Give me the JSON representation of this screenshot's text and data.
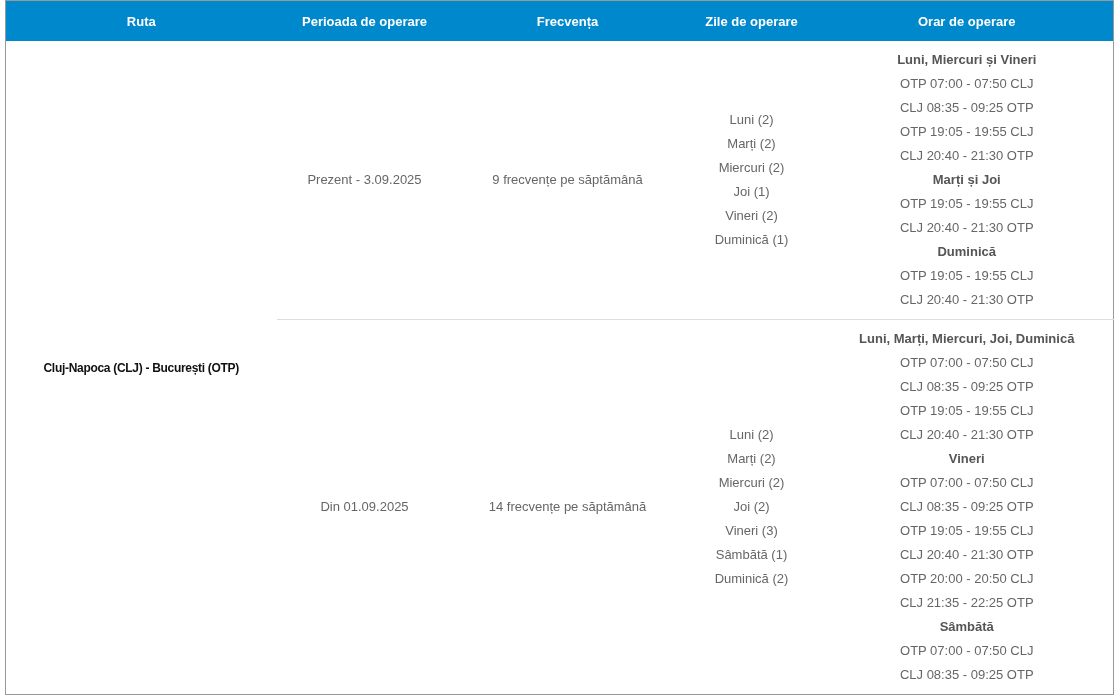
{
  "table": {
    "columns": [
      "Ruta",
      "Perioada de operare",
      "Frecvența",
      "Zile de operare",
      "Orar de operare"
    ],
    "route": "Cluj-Napoca (CLJ) - București (OTP)",
    "rows": [
      {
        "period": "Prezent - 3.09.2025",
        "frequency": "9 frecvențe pe săptămână",
        "days": [
          "Luni (2)",
          "Marți (2)",
          "Miercuri (2)",
          "Joi (1)",
          "Vineri (2)",
          "Duminică (1)"
        ],
        "schedule": [
          {
            "kind": "heading",
            "text": "Luni, Miercuri și Vineri"
          },
          {
            "kind": "time",
            "text": "OTP 07:00 - 07:50 CLJ"
          },
          {
            "kind": "time",
            "text": "CLJ 08:35 - 09:25 OTP"
          },
          {
            "kind": "time",
            "text": "OTP 19:05 - 19:55 CLJ"
          },
          {
            "kind": "time",
            "text": "CLJ 20:40 - 21:30 OTP"
          },
          {
            "kind": "heading",
            "text": "Marți și Joi"
          },
          {
            "kind": "time",
            "text": "OTP 19:05 - 19:55 CLJ"
          },
          {
            "kind": "time",
            "text": "CLJ 20:40 - 21:30 OTP"
          },
          {
            "kind": "heading",
            "text": "Duminică"
          },
          {
            "kind": "time",
            "text": "OTP 19:05 - 19:55 CLJ"
          },
          {
            "kind": "time",
            "text": "CLJ 20:40 - 21:30 OTP"
          }
        ]
      },
      {
        "period": "Din 01.09.2025",
        "frequency": "14 frecvențe pe săptămână",
        "days": [
          "Luni (2)",
          "Marți (2)",
          "Miercuri (2)",
          "Joi (2)",
          "Vineri (3)",
          "Sâmbătă (1)",
          "Duminică (2)"
        ],
        "schedule": [
          {
            "kind": "heading",
            "text": "Luni, Marți, Miercuri, Joi, Duminică"
          },
          {
            "kind": "time",
            "text": "OTP 07:00 - 07:50 CLJ"
          },
          {
            "kind": "time",
            "text": "CLJ 08:35 - 09:25 OTP"
          },
          {
            "kind": "time",
            "text": "OTP 19:05 - 19:55 CLJ"
          },
          {
            "kind": "time",
            "text": "CLJ 20:40 - 21:30 OTP"
          },
          {
            "kind": "heading",
            "text": "Vineri"
          },
          {
            "kind": "time",
            "text": "OTP 07:00 - 07:50 CLJ"
          },
          {
            "kind": "time",
            "text": "CLJ 08:35 - 09:25 OTP"
          },
          {
            "kind": "time",
            "text": "OTP 19:05 - 19:55 CLJ"
          },
          {
            "kind": "time",
            "text": "CLJ 20:40 - 21:30 OTP"
          },
          {
            "kind": "time",
            "text": "OTP 20:00 - 20:50 CLJ"
          },
          {
            "kind": "time",
            "text": "CLJ 21:35 - 22:25 OTP"
          },
          {
            "kind": "heading",
            "text": "Sâmbătă"
          },
          {
            "kind": "time",
            "text": "OTP 07:00 - 07:50 CLJ"
          },
          {
            "kind": "time",
            "text": "CLJ 08:35 - 09:25 OTP"
          }
        ]
      }
    ]
  }
}
